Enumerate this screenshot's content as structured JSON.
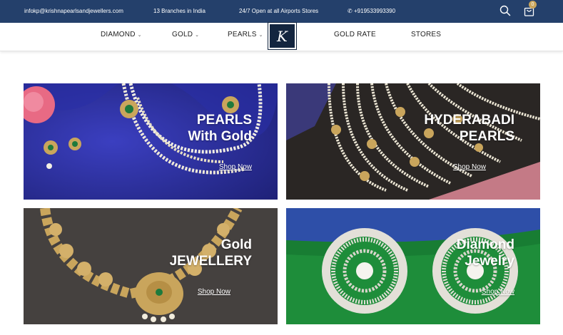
{
  "topbar": {
    "email": "infokp@krishnapearlsandjewellers.com",
    "branches": "13 Branches in India",
    "airports": "24/7 Open at all Airports Stores",
    "phone": "+919533993390",
    "cart_count": "0",
    "background_color": "#24406b"
  },
  "nav": {
    "items": [
      {
        "label": "DIAMOND",
        "has_dropdown": true
      },
      {
        "label": "GOLD",
        "has_dropdown": true
      },
      {
        "label": "PEARLS",
        "has_dropdown": true
      },
      {
        "label": "GOLD RATE",
        "has_dropdown": false
      },
      {
        "label": "STORES",
        "has_dropdown": false
      }
    ],
    "logo_letter": "K"
  },
  "banners": [
    {
      "title_line1": "PEARLS",
      "title_line2": "With Gold",
      "cta": "Shop Now",
      "bg_color": "#2b2f9c"
    },
    {
      "title_line1": "HYDERABADI",
      "title_line2": "PEARLS",
      "cta": "Shop Now",
      "bg_color": "#2a2624"
    },
    {
      "title_line1": "Gold",
      "title_line2": "JEWELLERY",
      "cta": "Shop Now",
      "bg_color": "#45413f"
    },
    {
      "title_line1": "Diamond",
      "title_line2": "Jewelry",
      "cta": "Shop Now",
      "bg_color": "#1e8d3a"
    }
  ]
}
